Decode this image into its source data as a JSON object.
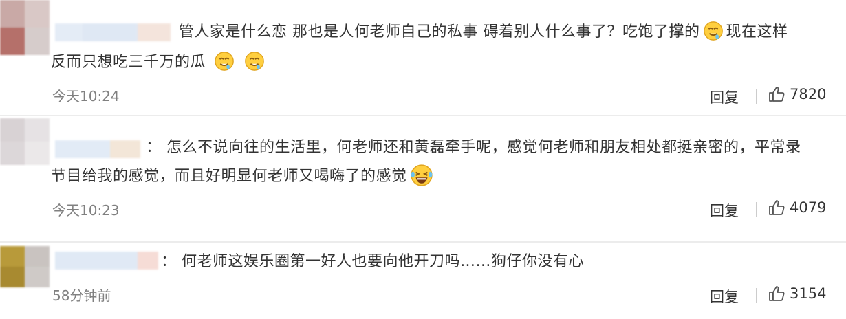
{
  "comments": [
    {
      "text_line1_a": "管人家是什么恋 那也是人何老师自己的私事 碍着别人什么事了？吃饱了撑的",
      "text_line1_b": "现在这样",
      "text_line2": "反而只想吃三千万的瓜",
      "time": "今天10:24",
      "reply_label": "回复",
      "likes": "7820"
    },
    {
      "text_line1": "： 怎么不说向往的生活里，何老师还和黄磊牵手呢，感觉何老师和朋友相处都挺亲密的，平常录",
      "text_line2": "节目给我的感觉，而且好明显何老师又喝嗨了的感觉",
      "time": "今天10:23",
      "reply_label": "回复",
      "likes": "4079"
    },
    {
      "text_line1": "： 何老师这娱乐圈第一好人也要向他开刀吗……狗仔你没有心",
      "time": "58分钟前",
      "reply_label": "回复",
      "likes": "3154"
    }
  ],
  "icons": {
    "emoji_drool": "drool-emoji-icon",
    "emoji_laugh": "laugh-cry-emoji-icon",
    "like": "thumbs-up-icon"
  },
  "colors": {
    "timestamp": "#808080",
    "divider": "#ececec",
    "emoji_yellow": "#ffcf3f"
  }
}
